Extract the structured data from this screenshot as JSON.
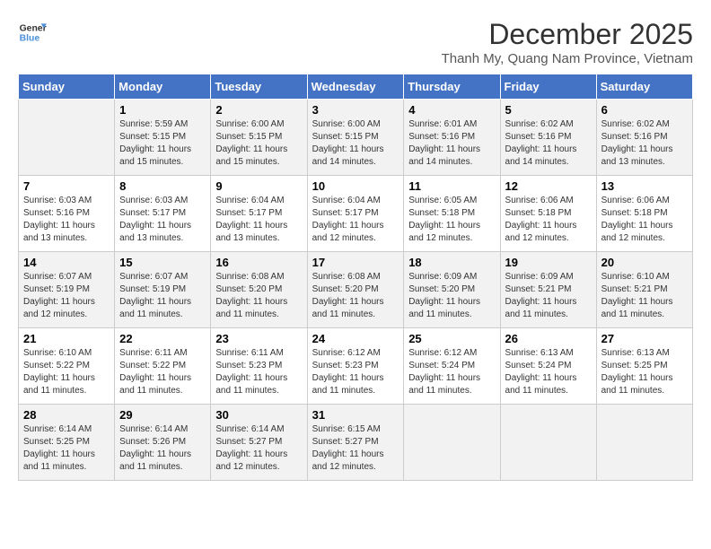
{
  "logo": {
    "text_general": "General",
    "text_blue": "Blue"
  },
  "title": "December 2025",
  "subtitle": "Thanh My, Quang Nam Province, Vietnam",
  "weekdays": [
    "Sunday",
    "Monday",
    "Tuesday",
    "Wednesday",
    "Thursday",
    "Friday",
    "Saturday"
  ],
  "weeks": [
    [
      {
        "day": "",
        "info": ""
      },
      {
        "day": "1",
        "info": "Sunrise: 5:59 AM\nSunset: 5:15 PM\nDaylight: 11 hours\nand 15 minutes."
      },
      {
        "day": "2",
        "info": "Sunrise: 6:00 AM\nSunset: 5:15 PM\nDaylight: 11 hours\nand 15 minutes."
      },
      {
        "day": "3",
        "info": "Sunrise: 6:00 AM\nSunset: 5:15 PM\nDaylight: 11 hours\nand 14 minutes."
      },
      {
        "day": "4",
        "info": "Sunrise: 6:01 AM\nSunset: 5:16 PM\nDaylight: 11 hours\nand 14 minutes."
      },
      {
        "day": "5",
        "info": "Sunrise: 6:02 AM\nSunset: 5:16 PM\nDaylight: 11 hours\nand 14 minutes."
      },
      {
        "day": "6",
        "info": "Sunrise: 6:02 AM\nSunset: 5:16 PM\nDaylight: 11 hours\nand 13 minutes."
      }
    ],
    [
      {
        "day": "7",
        "info": "Sunrise: 6:03 AM\nSunset: 5:16 PM\nDaylight: 11 hours\nand 13 minutes."
      },
      {
        "day": "8",
        "info": "Sunrise: 6:03 AM\nSunset: 5:17 PM\nDaylight: 11 hours\nand 13 minutes."
      },
      {
        "day": "9",
        "info": "Sunrise: 6:04 AM\nSunset: 5:17 PM\nDaylight: 11 hours\nand 13 minutes."
      },
      {
        "day": "10",
        "info": "Sunrise: 6:04 AM\nSunset: 5:17 PM\nDaylight: 11 hours\nand 12 minutes."
      },
      {
        "day": "11",
        "info": "Sunrise: 6:05 AM\nSunset: 5:18 PM\nDaylight: 11 hours\nand 12 minutes."
      },
      {
        "day": "12",
        "info": "Sunrise: 6:06 AM\nSunset: 5:18 PM\nDaylight: 11 hours\nand 12 minutes."
      },
      {
        "day": "13",
        "info": "Sunrise: 6:06 AM\nSunset: 5:18 PM\nDaylight: 11 hours\nand 12 minutes."
      }
    ],
    [
      {
        "day": "14",
        "info": "Sunrise: 6:07 AM\nSunset: 5:19 PM\nDaylight: 11 hours\nand 12 minutes."
      },
      {
        "day": "15",
        "info": "Sunrise: 6:07 AM\nSunset: 5:19 PM\nDaylight: 11 hours\nand 11 minutes."
      },
      {
        "day": "16",
        "info": "Sunrise: 6:08 AM\nSunset: 5:20 PM\nDaylight: 11 hours\nand 11 minutes."
      },
      {
        "day": "17",
        "info": "Sunrise: 6:08 AM\nSunset: 5:20 PM\nDaylight: 11 hours\nand 11 minutes."
      },
      {
        "day": "18",
        "info": "Sunrise: 6:09 AM\nSunset: 5:20 PM\nDaylight: 11 hours\nand 11 minutes."
      },
      {
        "day": "19",
        "info": "Sunrise: 6:09 AM\nSunset: 5:21 PM\nDaylight: 11 hours\nand 11 minutes."
      },
      {
        "day": "20",
        "info": "Sunrise: 6:10 AM\nSunset: 5:21 PM\nDaylight: 11 hours\nand 11 minutes."
      }
    ],
    [
      {
        "day": "21",
        "info": "Sunrise: 6:10 AM\nSunset: 5:22 PM\nDaylight: 11 hours\nand 11 minutes."
      },
      {
        "day": "22",
        "info": "Sunrise: 6:11 AM\nSunset: 5:22 PM\nDaylight: 11 hours\nand 11 minutes."
      },
      {
        "day": "23",
        "info": "Sunrise: 6:11 AM\nSunset: 5:23 PM\nDaylight: 11 hours\nand 11 minutes."
      },
      {
        "day": "24",
        "info": "Sunrise: 6:12 AM\nSunset: 5:23 PM\nDaylight: 11 hours\nand 11 minutes."
      },
      {
        "day": "25",
        "info": "Sunrise: 6:12 AM\nSunset: 5:24 PM\nDaylight: 11 hours\nand 11 minutes."
      },
      {
        "day": "26",
        "info": "Sunrise: 6:13 AM\nSunset: 5:24 PM\nDaylight: 11 hours\nand 11 minutes."
      },
      {
        "day": "27",
        "info": "Sunrise: 6:13 AM\nSunset: 5:25 PM\nDaylight: 11 hours\nand 11 minutes."
      }
    ],
    [
      {
        "day": "28",
        "info": "Sunrise: 6:14 AM\nSunset: 5:25 PM\nDaylight: 11 hours\nand 11 minutes."
      },
      {
        "day": "29",
        "info": "Sunrise: 6:14 AM\nSunset: 5:26 PM\nDaylight: 11 hours\nand 11 minutes."
      },
      {
        "day": "30",
        "info": "Sunrise: 6:14 AM\nSunset: 5:27 PM\nDaylight: 11 hours\nand 12 minutes."
      },
      {
        "day": "31",
        "info": "Sunrise: 6:15 AM\nSunset: 5:27 PM\nDaylight: 11 hours\nand 12 minutes."
      },
      {
        "day": "",
        "info": ""
      },
      {
        "day": "",
        "info": ""
      },
      {
        "day": "",
        "info": ""
      }
    ]
  ]
}
